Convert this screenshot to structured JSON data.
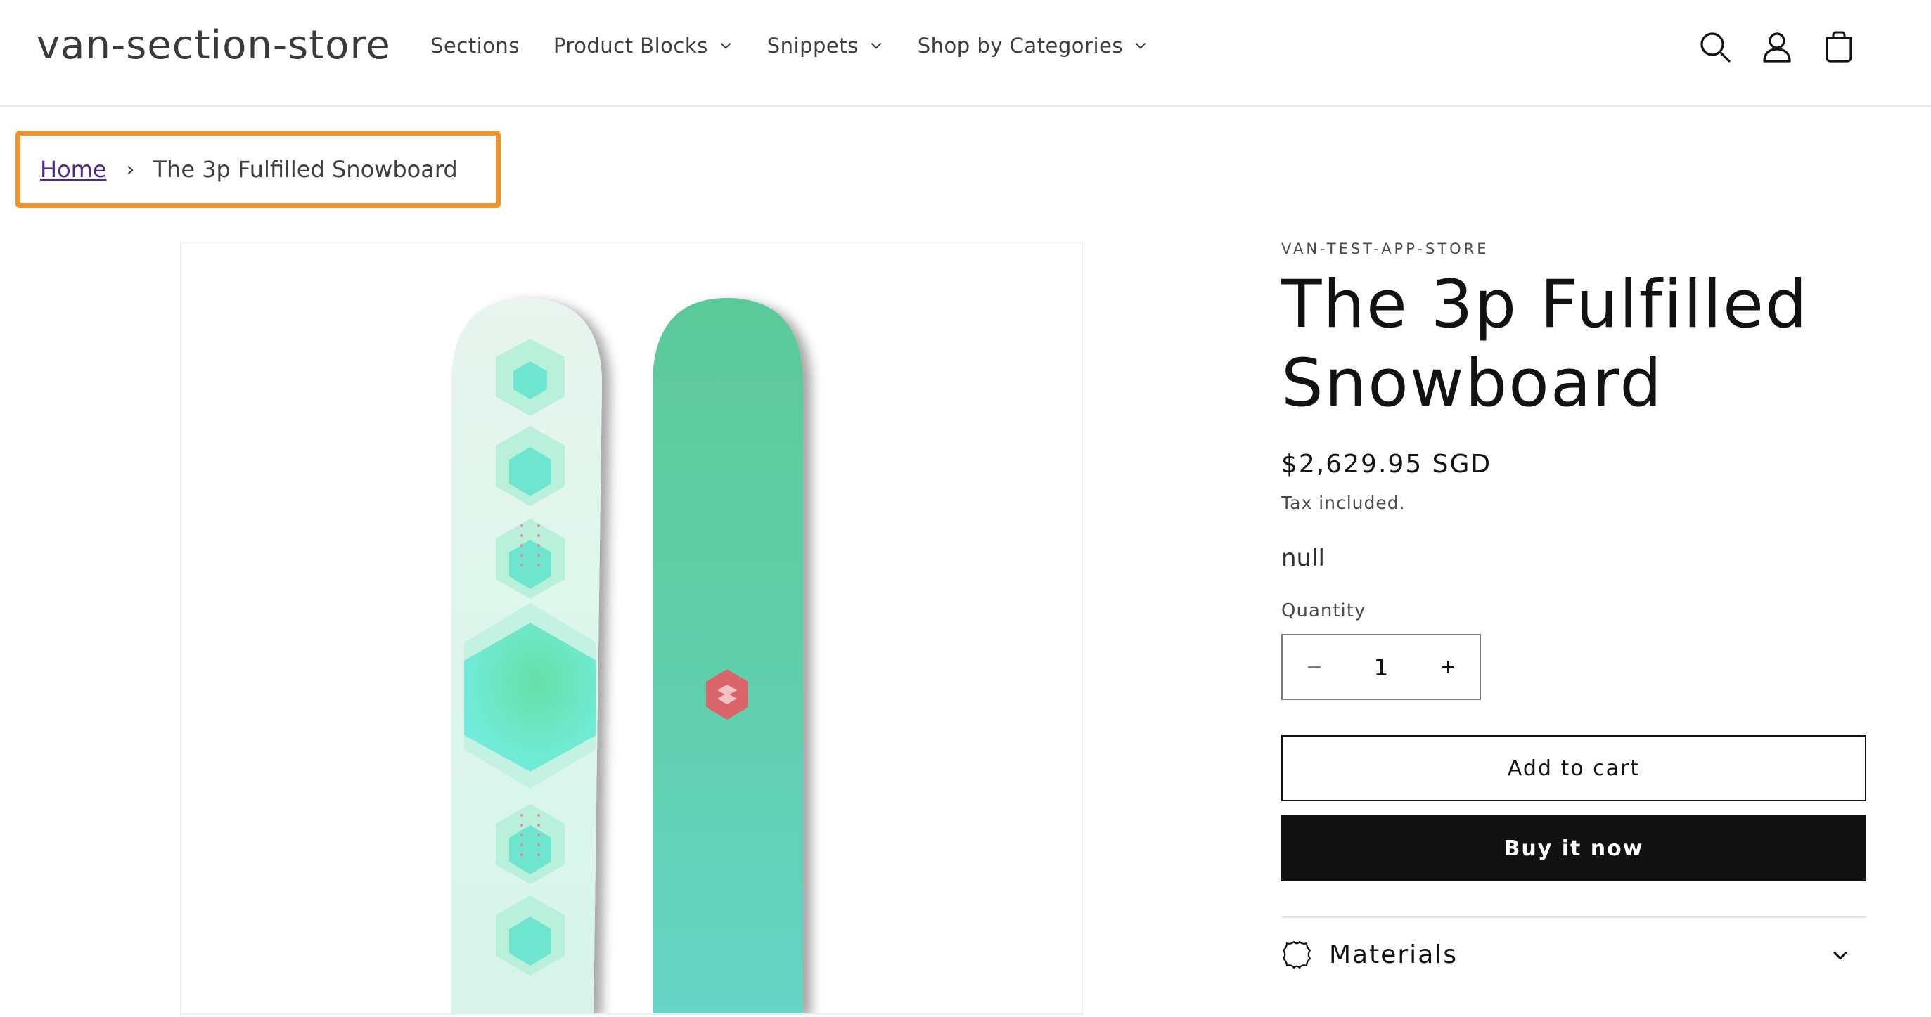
{
  "header": {
    "store_name": "van-section-store",
    "nav": [
      {
        "label": "Sections",
        "has_dropdown": false
      },
      {
        "label": "Product Blocks",
        "has_dropdown": true
      },
      {
        "label": "Snippets",
        "has_dropdown": true
      },
      {
        "label": "Shop by Categories",
        "has_dropdown": true
      }
    ],
    "icons": [
      "search-icon",
      "account-icon",
      "cart-icon"
    ]
  },
  "breadcrumb": {
    "home_label": "Home",
    "separator": "›",
    "current_label": "The 3p Fulfilled Snowboard",
    "highlight_color": "#f0922f"
  },
  "product": {
    "vendor": "VAN-TEST-APP-STORE",
    "title": "The 3p Fulfilled Snowboard",
    "price": "$2,629.95 SGD",
    "tax_note": "Tax included.",
    "description": "null",
    "quantity_label": "Quantity",
    "quantity_value": "1",
    "add_to_cart_label": "Add to cart",
    "buy_now_label": "Buy it now",
    "accordion_label": "Materials"
  },
  "colors": {
    "link": "#4b2a87",
    "primary": "#121212",
    "board_mint": "#6ee8d2",
    "board_green": "#5cc79a",
    "logo_red": "#d9646a"
  }
}
